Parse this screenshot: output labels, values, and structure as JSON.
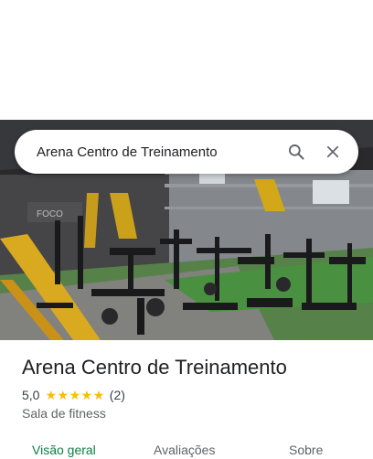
{
  "search": {
    "query": "Arena Centro de Treinamento"
  },
  "icons": {
    "search": "search-icon",
    "close": "close-icon"
  },
  "place": {
    "name": "Arena Centro de Treinamento",
    "rating": "5,0",
    "stars": 5,
    "review_count": "(2)",
    "category": "Sala de fitness",
    "photo_sign": "FOCO"
  },
  "tabs": [
    {
      "label": "Visão geral",
      "active": true
    },
    {
      "label": "Avaliações",
      "active": false
    },
    {
      "label": "Sobre",
      "active": false
    }
  ],
  "colors": {
    "accent": "#0b8043",
    "star": "#fbbc04",
    "text_primary": "#202124",
    "text_secondary": "#5f6368"
  }
}
